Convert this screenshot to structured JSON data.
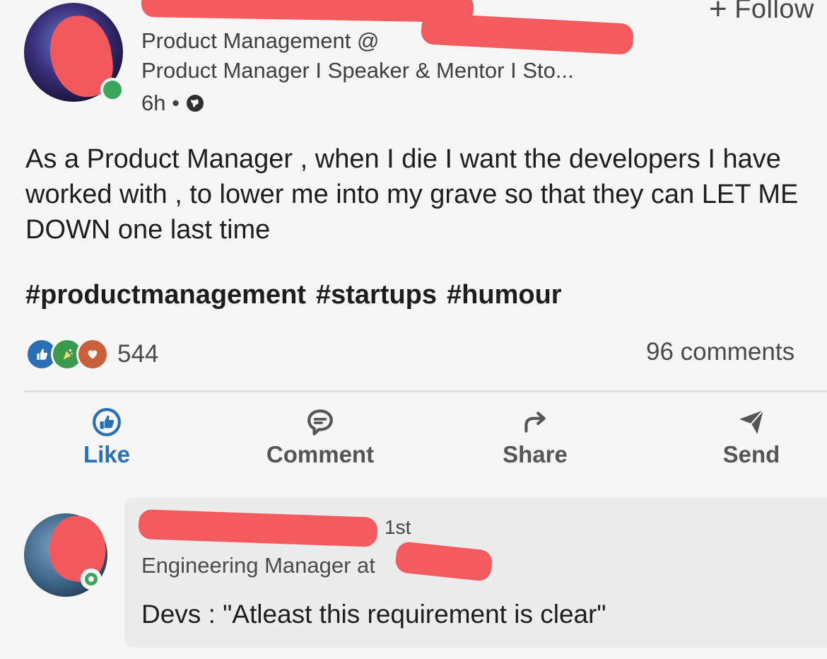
{
  "post": {
    "author_headline_1": "Product Management @",
    "author_headline_2": "Product Manager I Speaker & Mentor I Sto...",
    "time": "6h •",
    "follow_label": "Follow",
    "text": "As a Product Manager , when I die I want the developers I have worked with , to lower me into my grave so that they can LET ME DOWN one last time",
    "hashtags": [
      "#productmanagement",
      "#startups",
      "#humour"
    ],
    "reaction_count": "544",
    "comments_count": "96 comments"
  },
  "actions": {
    "like": "Like",
    "comment": "Comment",
    "share": "Share",
    "send": "Send"
  },
  "comment": {
    "degree": "1st",
    "headline": "Engineering Manager at",
    "text": "Devs : \"Atleast this requirement is clear\""
  },
  "colors": {
    "like_blue": "#2a6fb3",
    "online_green": "#3aa55b",
    "redaction": "#f35b5f"
  }
}
